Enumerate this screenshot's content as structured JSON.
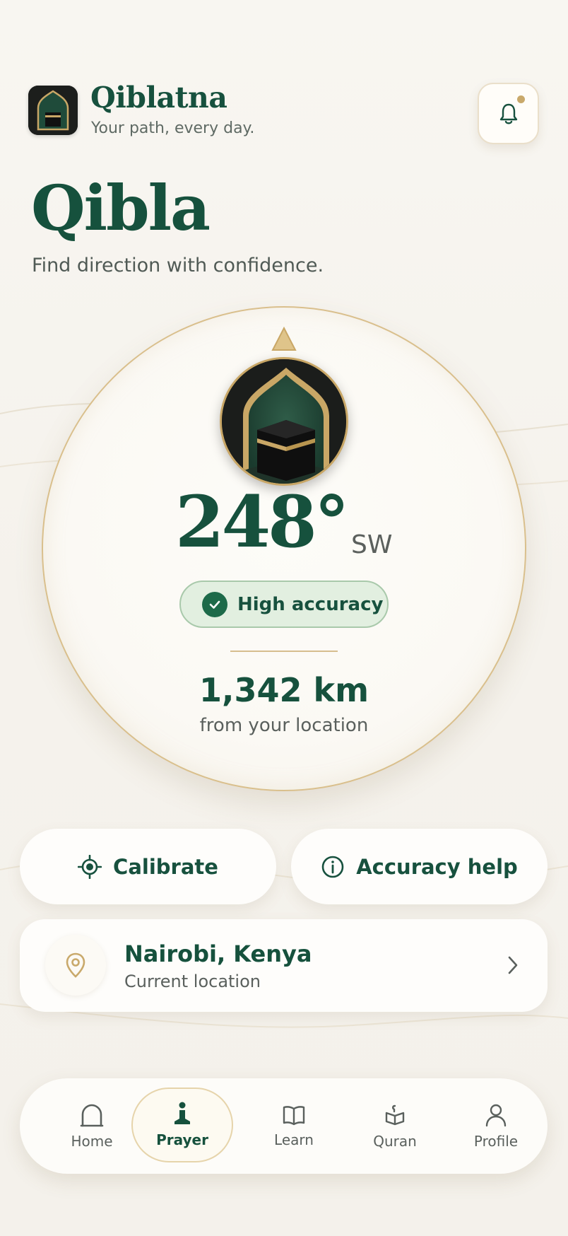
{
  "app": {
    "name": "Qiblatna",
    "tagline": "Your path, every day."
  },
  "page": {
    "title": "Qibla",
    "subtitle": "Find direction with confidence."
  },
  "compass": {
    "heading": "248°",
    "direction": "SW",
    "accuracy_label": "High accuracy",
    "distance": "1,342 km",
    "distance_label": "from your location"
  },
  "actions": {
    "calibrate_label": "Calibrate",
    "help_label": "Accuracy help"
  },
  "location": {
    "name": "Nairobi, Kenya",
    "subtitle": "Current location"
  },
  "nav": {
    "items": [
      {
        "label": "Home",
        "icon": "home-arch-icon"
      },
      {
        "label": "Prayer",
        "icon": "prayer-person-icon",
        "active": true
      },
      {
        "label": "Learn",
        "icon": "open-book-icon"
      },
      {
        "label": "Quran",
        "icon": "quran-stand-icon"
      },
      {
        "label": "Profile",
        "icon": "person-icon"
      }
    ]
  },
  "colors": {
    "primary_green": "#16513d",
    "gold": "#c9a96b",
    "badge_green": "#e2efe0",
    "background": "#f7f4ee"
  }
}
